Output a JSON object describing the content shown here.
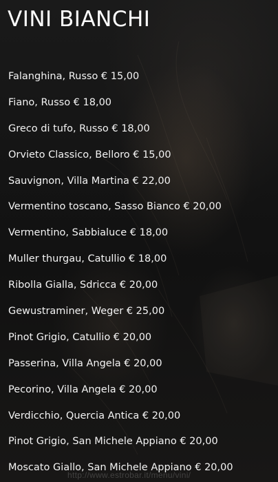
{
  "title": "VINI BIANCHI",
  "wines": [
    "Falanghina, Russo € 15,00",
    "Fiano, Russo € 18,00",
    "Greco di tufo, Russo € 18,00",
    "Orvieto Classico, Belloro € 15,00",
    "Sauvignon, Villa Martina € 22,00",
    "Vermentino toscano, Sasso Bianco € 20,00",
    "Vermentino, Sabbialuce € 18,00",
    "Muller thurgau, Catullio € 18,00",
    "Ribolla Gialla, Sdricca € 20,00",
    "Gewustraminer, Weger € 25,00",
    "Pinot Grigio, Catullio € 20,00",
    "Passerina, Villa Angela € 20,00",
    "Pecorino, Villa Angela € 20,00",
    "Verdicchio, Quercia Antica € 20,00",
    "Pinot Grigio, San Michele Appiano € 20,00",
    "Moscato Giallo, San Michele Appiano € 20,00"
  ],
  "watermark": "http://www.estrobar.it/menu/vini/"
}
